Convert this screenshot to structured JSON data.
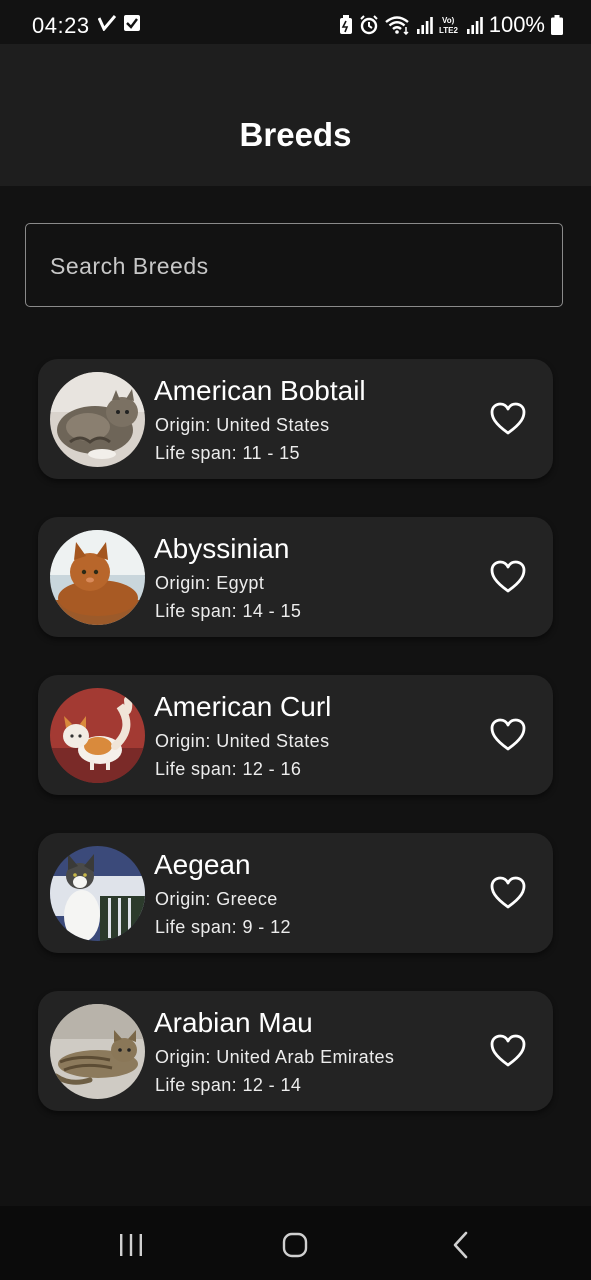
{
  "status_bar": {
    "time": "04:23",
    "battery": "100%",
    "icons": [
      "check-mark-icon",
      "checkbox-icon",
      "battery-saver-icon",
      "alarm-icon",
      "wifi-icon",
      "signal-icon",
      "volte-icon",
      "signal-icon-2",
      "battery-icon"
    ],
    "lte_label": "LTE2",
    "vo_label": "Vo)"
  },
  "app_bar": {
    "title": "Breeds"
  },
  "search": {
    "placeholder": "Search Breeds"
  },
  "breeds": [
    {
      "name": "American Bobtail",
      "origin": "Origin: United States",
      "life_span": "Life span: 11 - 15",
      "favorite": false
    },
    {
      "name": "Abyssinian",
      "origin": "Origin: Egypt",
      "life_span": "Life span: 14 - 15",
      "favorite": false
    },
    {
      "name": "American Curl",
      "origin": "Origin: United States",
      "life_span": "Life span: 12 - 16",
      "favorite": false
    },
    {
      "name": "Aegean",
      "origin": "Origin: Greece",
      "life_span": "Life span: 9 - 12",
      "favorite": false
    },
    {
      "name": "Arabian Mau",
      "origin": "Origin: United Arab Emirates",
      "life_span": "Life span: 12 - 14",
      "favorite": false
    }
  ],
  "nav_bar": {
    "buttons": [
      "recent-apps-icon",
      "home-icon",
      "back-icon"
    ]
  },
  "colors": {
    "background": "#121212",
    "app_bar": "#1e1e1e",
    "card": "#232323",
    "text": "#ffffff"
  }
}
